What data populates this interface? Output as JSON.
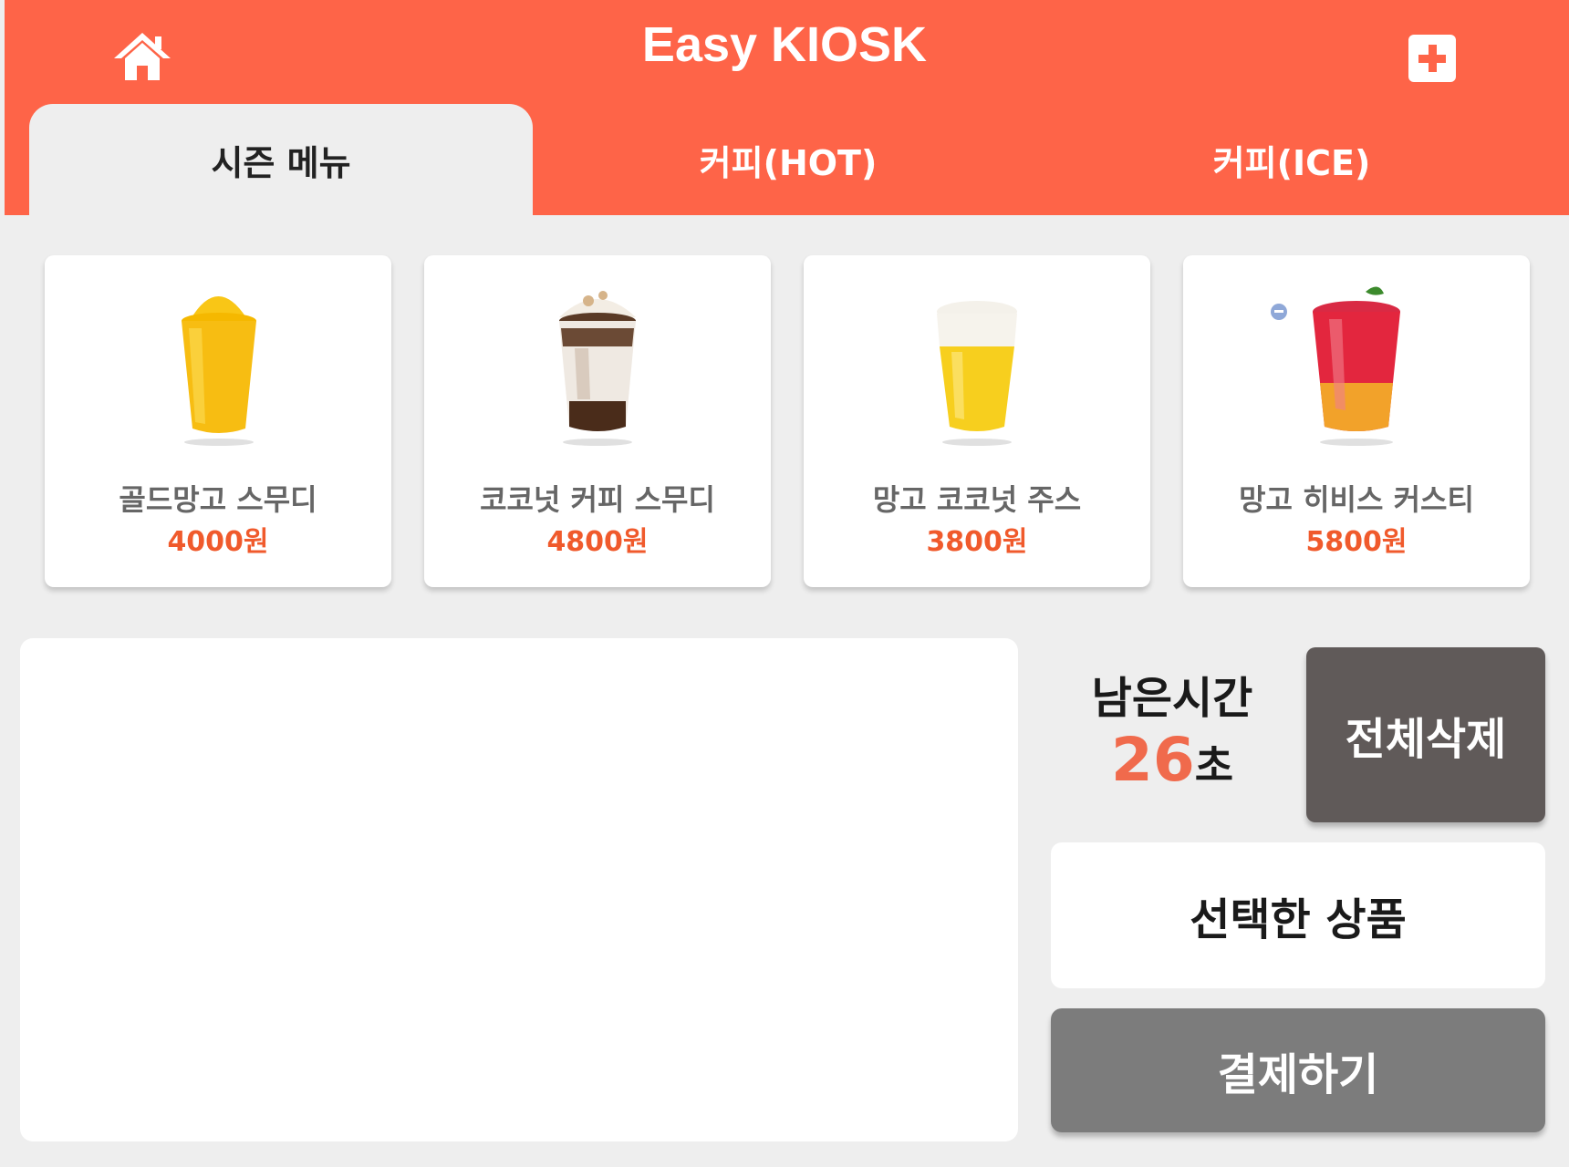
{
  "header": {
    "title": "Easy KIOSK",
    "home_icon": "home-icon",
    "add_icon": "plus-box-icon"
  },
  "tabs": [
    {
      "label": "시즌 메뉴",
      "active": true
    },
    {
      "label": "커피(HOT)",
      "active": false
    },
    {
      "label": "커피(ICE)",
      "active": false
    }
  ],
  "menu": [
    {
      "name": "골드망고 스무디",
      "price": "4000원"
    },
    {
      "name": "코코넛 커피 스무디",
      "price": "4800원"
    },
    {
      "name": "망고 코코넛 주스",
      "price": "3800원"
    },
    {
      "name": "망고 히비스 커스티",
      "price": "5800원"
    }
  ],
  "timer": {
    "label": "남은시간",
    "value": "26",
    "unit": "초"
  },
  "buttons": {
    "clear_all": "전체삭제",
    "selected": "선택한 상품",
    "pay": "결제하기"
  },
  "colors": {
    "brand": "#fe6448",
    "price": "#f05a2c",
    "dark_button": "#605a59",
    "pay_button": "#7c7c7c"
  }
}
